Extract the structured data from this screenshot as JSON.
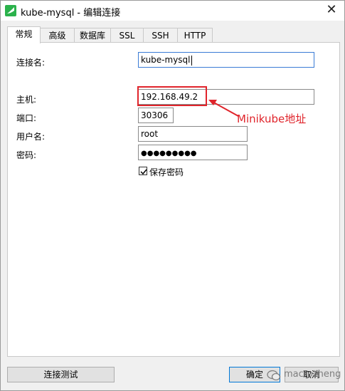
{
  "window": {
    "title": "kube-mysql - 编辑连接",
    "close_glyph": "✕"
  },
  "tabs": [
    {
      "label": "常规",
      "active": true
    },
    {
      "label": "高级",
      "active": false
    },
    {
      "label": "数据库",
      "active": false
    },
    {
      "label": "SSL",
      "active": false
    },
    {
      "label": "SSH",
      "active": false
    },
    {
      "label": "HTTP",
      "active": false
    }
  ],
  "form": {
    "connection_name_label": "连接名:",
    "connection_name_value": "kube-mysql",
    "host_label": "主机:",
    "host_value": "192.168.49.2",
    "port_label": "端口:",
    "port_value": "30306",
    "username_label": "用户名:",
    "username_value": "root",
    "password_label": "密码:",
    "password_masked": "●●●●●●●●●",
    "save_password_label": "保存密码",
    "save_password_checked": true
  },
  "annotation": {
    "text": "Minikube地址",
    "color": "#e0242b"
  },
  "buttons": {
    "test_connection": "连接测试",
    "ok": "确定",
    "cancel": "取消"
  },
  "watermark": {
    "text": "macrozheng"
  },
  "icons": {
    "app": "navicat-app-icon",
    "close": "close-icon",
    "check": "checkmark-icon",
    "arrow": "arrow-icon",
    "watermark": "wechat-icon"
  }
}
